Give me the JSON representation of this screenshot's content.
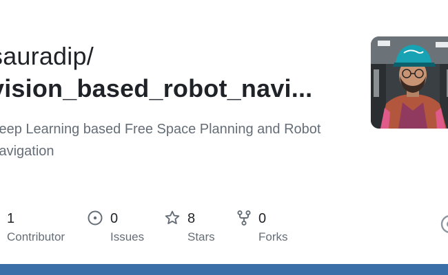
{
  "repo": {
    "owner": "sauradip/",
    "name": "vision_based_robot_navi...",
    "description": "Deep Learning based Free Space Planning and Robot Navigation"
  },
  "avatar": {
    "icon": "user-avatar-photo"
  },
  "stats": {
    "contributors": {
      "value": "1",
      "label": "Contributor",
      "icon": "people-icon"
    },
    "issues": {
      "value": "0",
      "label": "Issues",
      "icon": "issue-opened-icon"
    },
    "stars": {
      "value": "8",
      "label": "Stars",
      "icon": "star-icon"
    },
    "forks": {
      "value": "0",
      "label": "Forks",
      "icon": "repo-forked-icon"
    }
  },
  "colors": {
    "bottom_bar": "#3b6fa7",
    "text_primary": "#1f2328",
    "text_muted": "#656d76"
  }
}
